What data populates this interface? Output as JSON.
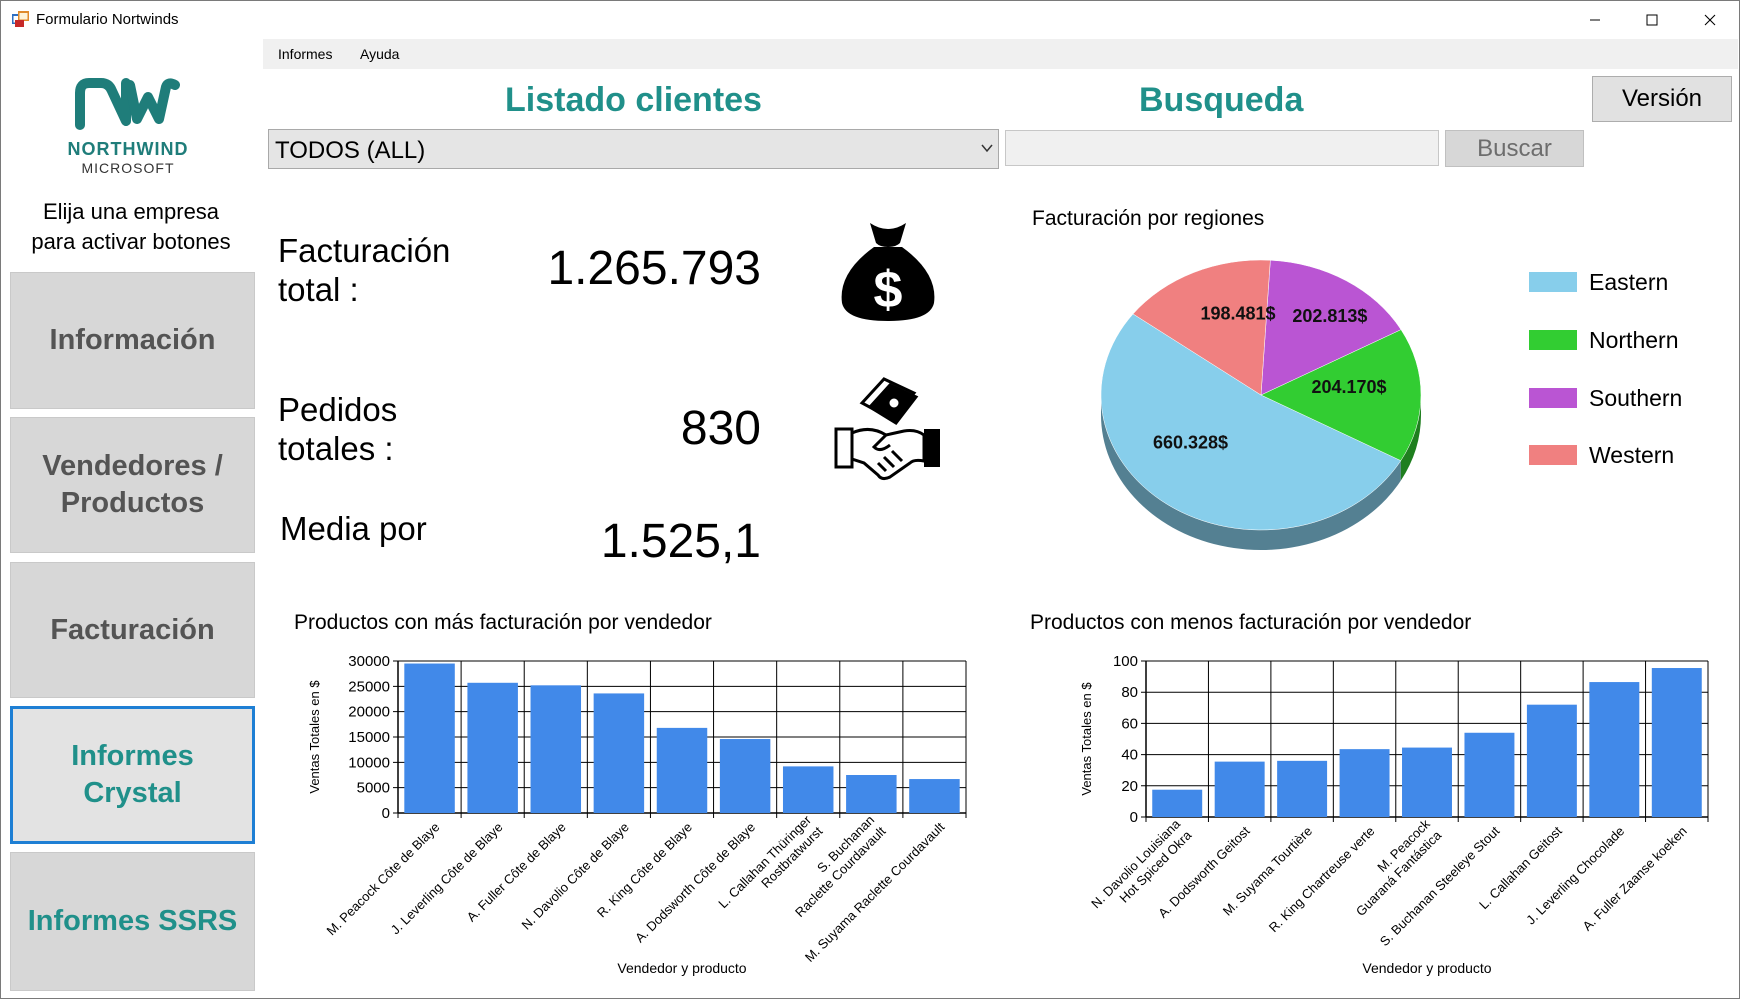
{
  "window": {
    "title": "Formulario Nortwinds"
  },
  "menu": {
    "items": [
      "Informes",
      "Ayuda"
    ]
  },
  "logo": {
    "text_main": "NORTHWIND",
    "text_sub": "MICROSOFT"
  },
  "sidebar": {
    "instruction_line1": "Elija una empresa",
    "instruction_line2": "para activar botones",
    "buttons": [
      {
        "line1": "Información",
        "line2": ""
      },
      {
        "line1": "Vendedores /",
        "line2": "Productos"
      },
      {
        "line1": "Facturación",
        "line2": ""
      },
      {
        "line1": "Informes",
        "line2": "Crystal"
      },
      {
        "line1": "Informes SSRS",
        "line2": ""
      }
    ]
  },
  "header": {
    "listado_title": "Listado clientes",
    "busqueda_title": "Busqueda",
    "version_label": "Versión",
    "combo_value": "TODOS (ALL)",
    "search_value": "",
    "search_button": "Buscar"
  },
  "stats": {
    "facturacion_label_1": "Facturación",
    "facturacion_label_2": "total :",
    "facturacion_value": "1.265.793",
    "pedidos_label_1": "Pedidos",
    "pedidos_label_2": "totales :",
    "pedidos_value": "830",
    "media_label": "Media por",
    "media_value": "1.525,1"
  },
  "colors": {
    "accent": "#20908a",
    "bar": "#4189e9",
    "active_border": "#1e7fd4"
  },
  "chart_data": [
    {
      "type": "pie",
      "title": "Facturación por regiones",
      "legend_position": "right",
      "slices": [
        {
          "name": "Eastern",
          "value": 660328,
          "label": "660.328$",
          "color": "#87ceeb"
        },
        {
          "name": "Northern",
          "value": 204170,
          "label": "204.170$",
          "color": "#32cd32"
        },
        {
          "name": "Southern",
          "value": 202813,
          "label": "202.813$",
          "color": "#ba55d3"
        },
        {
          "name": "Western",
          "value": 198481,
          "label": "198.481$",
          "color": "#f08080"
        }
      ]
    },
    {
      "type": "bar",
      "title": "Productos con más facturación por vendedor",
      "xlabel": "Vendedor y producto",
      "ylabel": "Ventas Totales en $",
      "ylim": [
        0,
        30000
      ],
      "yticks": [
        0,
        5000,
        10000,
        15000,
        20000,
        25000,
        30000
      ],
      "grid": true,
      "categories": [
        "M. Peacock Côte de Blaye",
        "J. Leverling Côte de Blaye",
        "A. Fuller Côte de Blaye",
        "N. Davolio Côte de Blaye",
        "R. King Côte de Blaye",
        "A. Dodsworth Côte de Blaye",
        "L. Callahan Thüringer Rostbratwurst",
        "S. Buchanan Raclette Courdavault",
        "M. Suyama Raclette Courdavault"
      ],
      "values": [
        29500,
        25700,
        25200,
        23600,
        16800,
        14600,
        9200,
        7500,
        6700
      ]
    },
    {
      "type": "bar",
      "title": "Productos con menos facturación por vendedor",
      "xlabel": "Vendedor y producto",
      "ylabel": "Ventas Totales en $",
      "ylim": [
        0,
        100
      ],
      "yticks": [
        0,
        20,
        40,
        60,
        80,
        100
      ],
      "grid": true,
      "categories": [
        "N. Davolio Louisiana Hot Spiced Okra",
        "A. Dodsworth Geitost",
        "M. Suyama Tourtière",
        "R. King Chartreuse verte",
        "M. Peacock Guaraná Fantástica",
        "S. Buchanan Steeleye Stout",
        "L. Callahan Geitost",
        "J. Leverling Chocolade",
        "A. Fuller Zaanse koeken"
      ],
      "values": [
        17.5,
        35.5,
        36,
        43.5,
        44.5,
        54,
        72,
        86.5,
        95.5
      ]
    }
  ]
}
